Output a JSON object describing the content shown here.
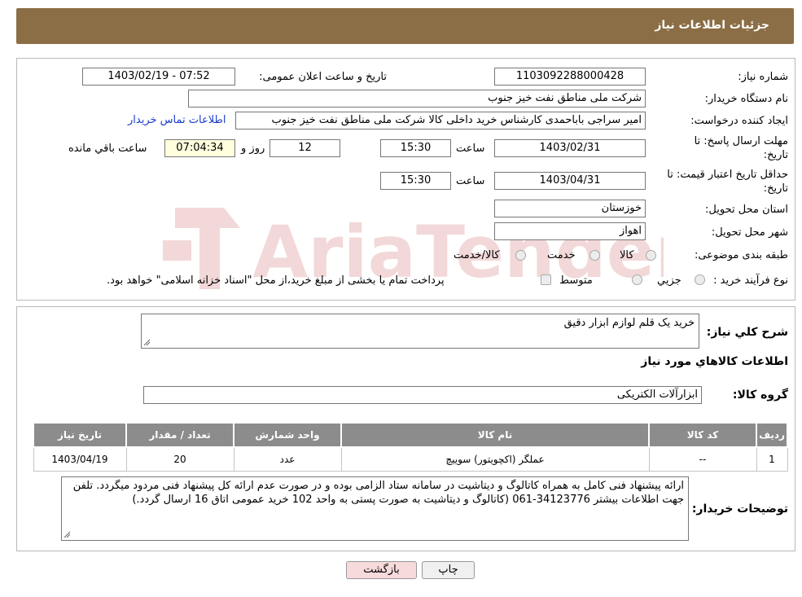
{
  "header": {
    "title": "جزئیات اطلاعات نیاز"
  },
  "form": {
    "need_number_label": "شماره نیاز:",
    "need_number": "1103092288000428",
    "announce_label": "تاریخ و ساعت اعلان عمومی:",
    "announce_value": "1403/02/19 - 07:52",
    "buyer_org_label": "نام دستگاه خریدار:",
    "buyer_org": "شرکت ملی مناطق نفت خیز جنوب",
    "creator_label": "ایجاد کننده درخواست:",
    "creator": "امیر  سراجی باباحمدی  کارشناس خرید داخلی کالا شرکت ملی مناطق نفت خیز جنوب",
    "contact_link": "اطلاعات تماس خریدار",
    "deadline_label_1": "مهلت ارسال پاسخ: تا",
    "deadline_label_2": "تاریخ:",
    "deadline_date": "1403/02/31",
    "time_label": "ساعت",
    "deadline_time": "15:30",
    "days_value": "12",
    "days_label": "روز و",
    "remaining_time": "07:04:34",
    "remaining_label": "ساعت باقي مانده",
    "validity_label_1": "حداقل تاریخ اعتبار قیمت: تا",
    "validity_label_2": "تاریخ:",
    "validity_date": "1403/04/31",
    "validity_time": "15:30",
    "province_label": "استان محل تحویل:",
    "province": "خوزستان",
    "city_label": "شهر محل تحویل:",
    "city": "اهواز",
    "category_label": "طبقه بندی موضوعی:",
    "category_options": [
      "کالا",
      "خدمت",
      "کالا/خدمت"
    ],
    "process_label": "نوع فرآیند خرید :",
    "process_options": [
      "جزيي",
      "متوسط"
    ],
    "process_note": "پرداخت تمام یا بخشی از مبلغ خرید،از محل \"اسناد خزانه اسلامی\" خواهد بود."
  },
  "details": {
    "summary_label": "شرح کلي نياز:",
    "summary": "خرید یک قلم لوازم ابزار دقیق",
    "items_title": "اطلاعات کالاهاي مورد نياز",
    "group_label": "گروه کالا:",
    "group": "ابزارآلات الکتریکی",
    "table": {
      "headers": [
        "رديف",
        "کد کالا",
        "نام کالا",
        "واحد شمارش",
        "تعداد / مقدار",
        "تاریخ نیاز"
      ],
      "rows": [
        [
          "1",
          "--",
          "عملگر (اکچویتور) سوییچ",
          "عدد",
          "20",
          "1403/04/19"
        ]
      ]
    },
    "buyer_notes_label": "توضیحات خریدار:",
    "buyer_notes": "ارائه پیشنهاد فنی کامل به همراه کاتالوگ و دیتاشیت در سامانه ستاد الزامی بوده و در صورت عدم ارائه کل پیشنهاد فنی مردود میگردد. تلفن جهت اطلاعات بیشتر 34123776-061  (کاتالوگ و دیتاشیت به صورت پستی به واحد 102 خرید عمومی اتاق 16 ارسال گردد.)"
  },
  "buttons": {
    "print": "چاپ",
    "back": "بازگشت"
  },
  "watermark": {
    "text": "AriaTender.neT"
  },
  "colors": {
    "header_bg": "#8b6e45",
    "link": "#1a3cc9",
    "table_header": "#8c8c8c",
    "back_button_bg": "#f7dada"
  }
}
